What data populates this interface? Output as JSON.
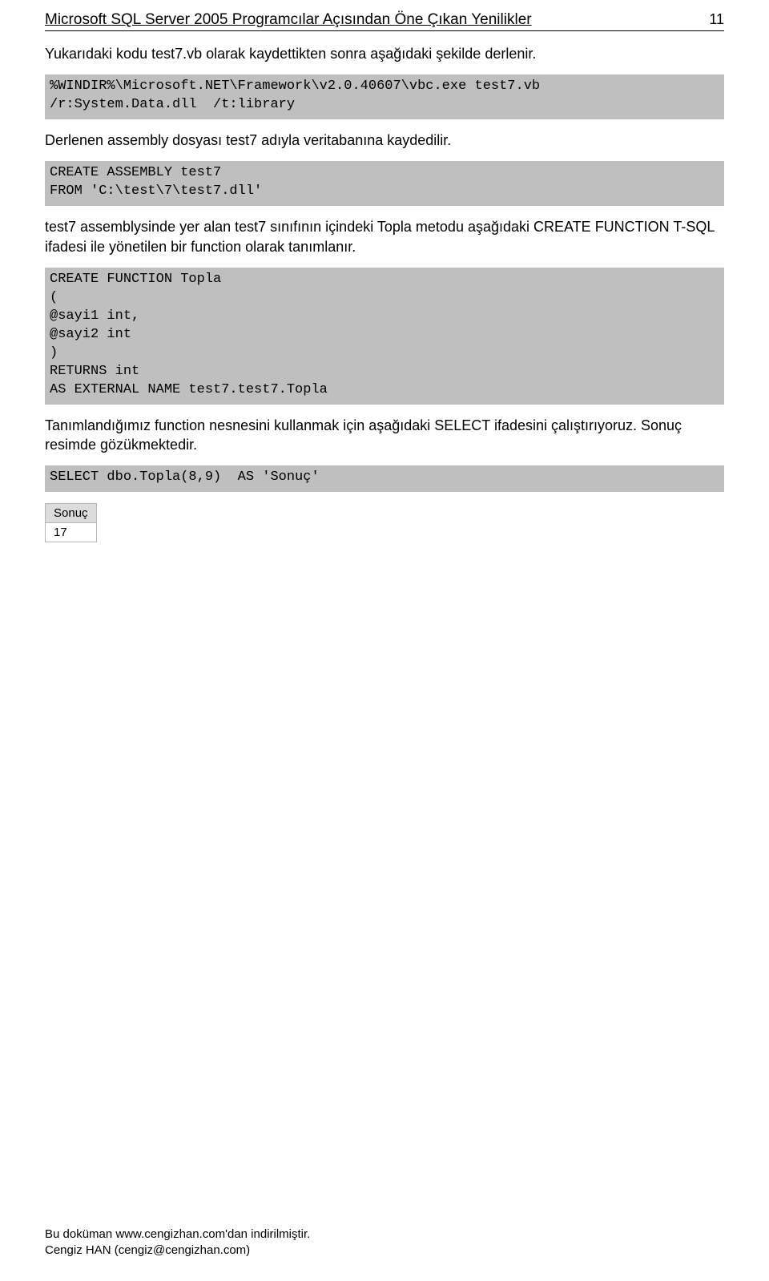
{
  "header": {
    "title": "Microsoft SQL Server 2005 Programcılar Açısından Öne Çıkan Yenilikler",
    "page_number": "11"
  },
  "para1": "Yukarıdaki kodu test7.vb olarak kaydettikten sonra aşağıdaki şekilde derlenir.",
  "code1": "%WINDIR%\\Microsoft.NET\\Framework\\v2.0.40607\\vbc.exe test7.vb\n/r:System.Data.dll  /t:library",
  "para2": "Derlenen assembly dosyası test7 adıyla veritabanına kaydedilir.",
  "code2": "CREATE ASSEMBLY test7\nFROM 'C:\\test\\7\\test7.dll'",
  "para3": "test7 assemblysinde yer alan test7 sınıfının içindeki Topla metodu aşağıdaki CREATE FUNCTION T-SQL ifadesi ile yönetilen bir function olarak tanımlanır.",
  "code3": "CREATE FUNCTION Topla\n(\n@sayi1 int,\n@sayi2 int\n)\nRETURNS int\nAS EXTERNAL NAME test7.test7.Topla",
  "para4": "Tanımlandığımız function nesnesini kullanmak için aşağıdaki SELECT ifadesini çalıştırıyoruz. Sonuç resimde gözükmektedir.",
  "code4": "SELECT dbo.Topla(8,9)  AS 'Sonuç'",
  "result": {
    "header": "Sonuç",
    "value": "17"
  },
  "footer": {
    "line1": "Bu doküman www.cengizhan.com'dan indirilmiştir.",
    "line2": "Cengiz HAN (cengiz@cengizhan.com)"
  }
}
